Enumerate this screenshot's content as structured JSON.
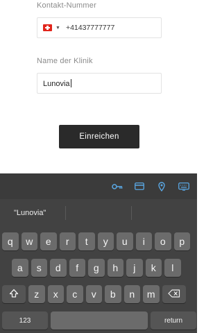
{
  "form": {
    "contact_label": "Kontakt-Nummer",
    "phone_value": "+41437777777",
    "clinic_label": "Name der Klinik",
    "clinic_value": "Lunovia",
    "submit_label": "Einreichen"
  },
  "accessory": {
    "icons": [
      "key-icon",
      "card-icon",
      "location-pin-icon",
      "keyboard-icon"
    ]
  },
  "keyboard": {
    "suggestion": "\"Lunovia\"",
    "row1": [
      "q",
      "w",
      "e",
      "r",
      "t",
      "y",
      "u",
      "i",
      "o",
      "p"
    ],
    "row2": [
      "a",
      "s",
      "d",
      "f",
      "g",
      "h",
      "j",
      "k",
      "l"
    ],
    "row3": [
      "z",
      "x",
      "c",
      "v",
      "b",
      "n",
      "m"
    ],
    "numbers_label": "123",
    "return_label": "return"
  },
  "colors": {
    "flag_red": "#e1251b",
    "button_bg": "#2a2a2a",
    "keyboard_bg": "#424242",
    "key_bg": "#6b6b6b",
    "accent_blue": "#5aa9e6"
  }
}
